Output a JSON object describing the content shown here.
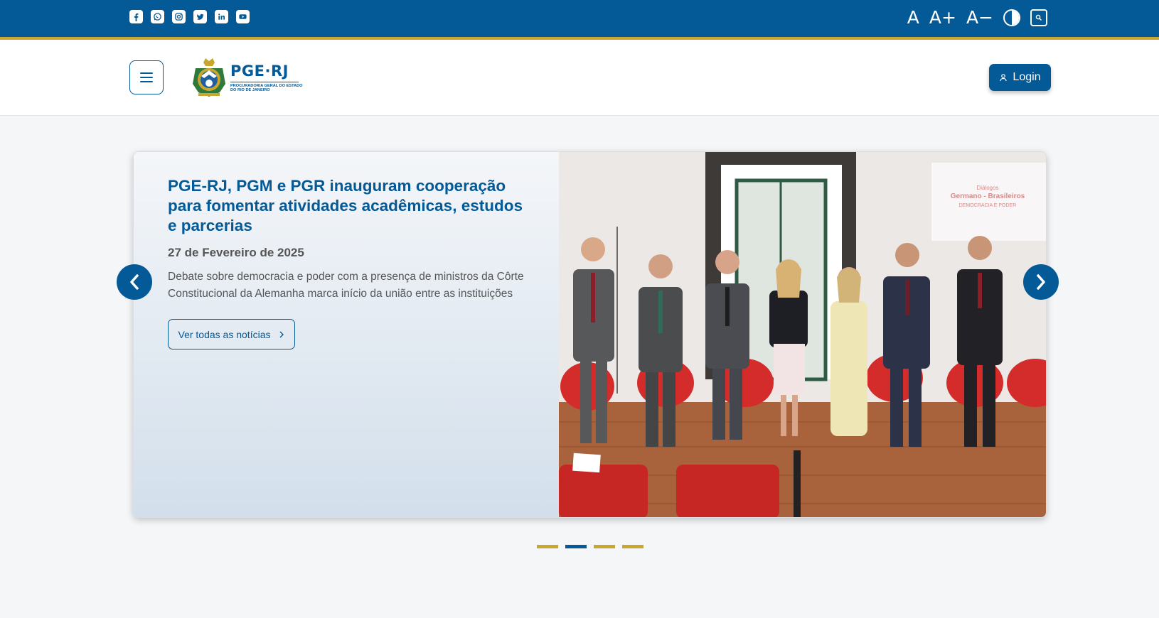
{
  "colors": {
    "primary": "#035a96",
    "gold": "#c9a630"
  },
  "topbar": {
    "social": [
      {
        "name": "facebook-icon"
      },
      {
        "name": "whatsapp-icon"
      },
      {
        "name": "instagram-icon"
      },
      {
        "name": "twitter-icon"
      },
      {
        "name": "linkedin-icon"
      },
      {
        "name": "youtube-icon"
      }
    ],
    "accessibility": {
      "font_reset": "A",
      "font_increase": "A+",
      "font_decrease": "A−"
    }
  },
  "header": {
    "logo_name": "PGE·RJ",
    "logo_sub_1": "PROCURADORIA GERAL DO ESTADO",
    "logo_sub_2": "DO RIO DE JANEIRO",
    "login_label": "Login"
  },
  "carousel": {
    "title": "PGE-RJ, PGM e PGR inauguram cooperação para fomentar atividades acadêmicas, estudos e parcerias",
    "date": "27 de Fevereiro de 2025",
    "description": "Debate sobre democracia e poder com a presença de ministros da Côrte Constitucional da Alemanha marca início da união entre as instituições",
    "button_label": "Ver todas as notícias",
    "screen_line_1": "Diálogos",
    "screen_line_2": "Germano - Brasileiros",
    "screen_line_3": "DEMOCRACIA E PODER",
    "indicators": [
      {
        "active": false
      },
      {
        "active": true
      },
      {
        "active": false
      },
      {
        "active": false
      }
    ]
  }
}
